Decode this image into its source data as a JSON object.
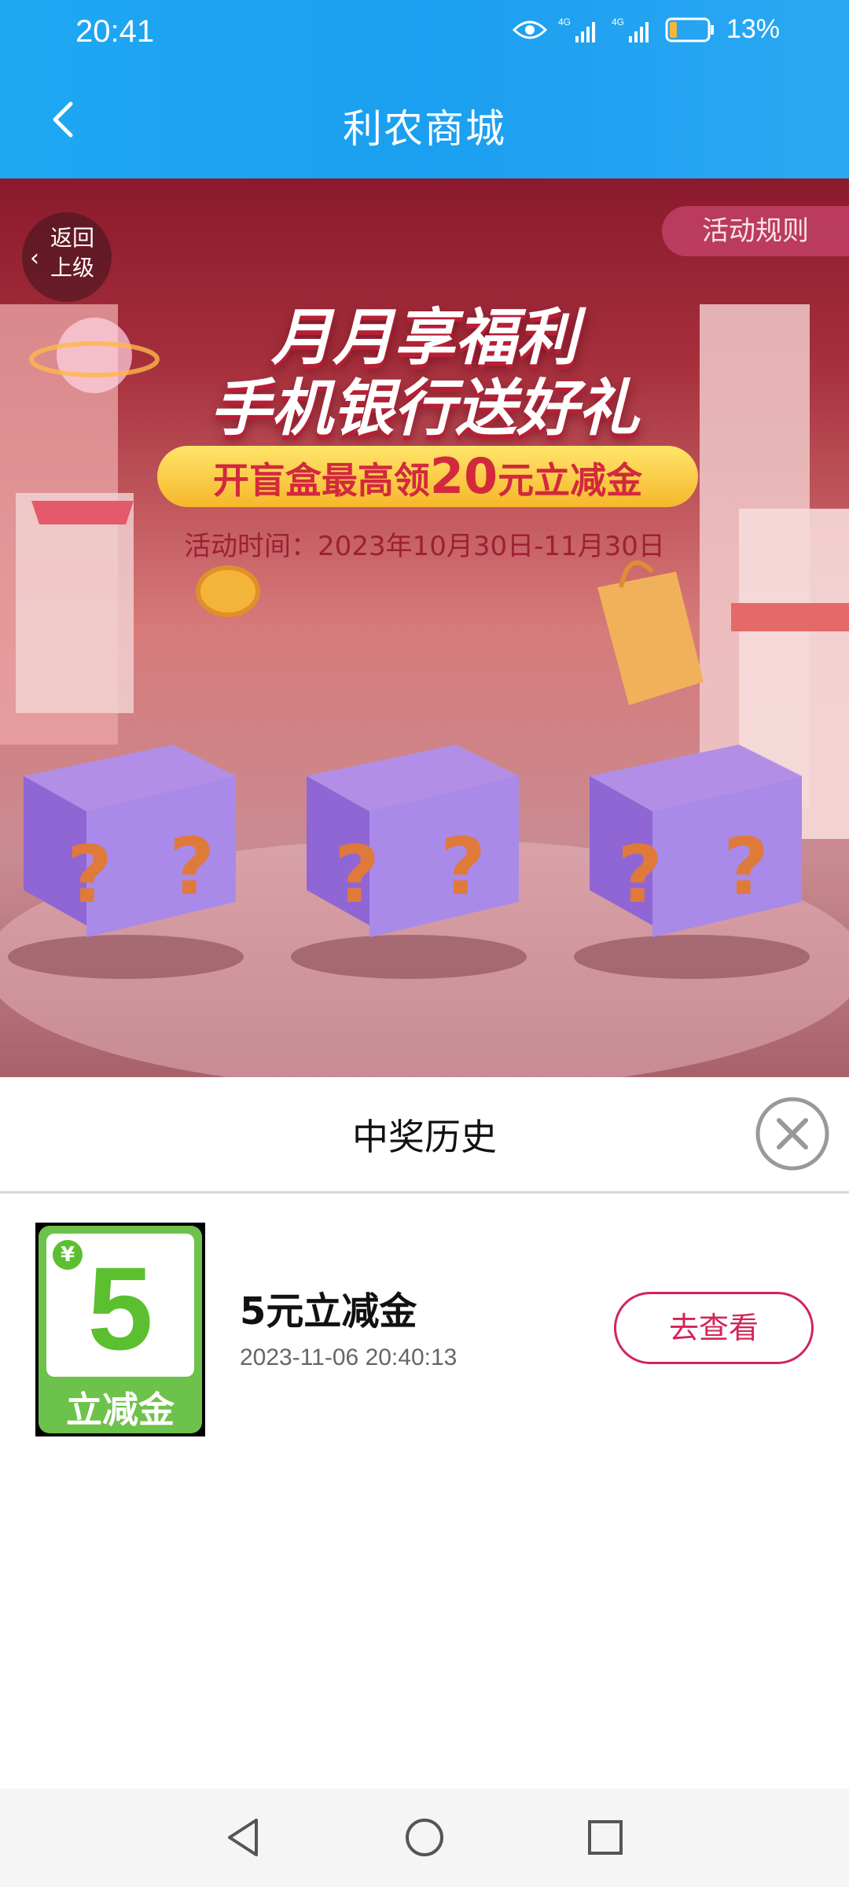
{
  "status_bar": {
    "time": "20:41",
    "network_1": "4G",
    "network_2": "4G",
    "battery": "13%"
  },
  "header": {
    "title": "利农商城"
  },
  "banner": {
    "return_label_1": "返回",
    "return_label_2": "上级",
    "rules_label": "活动规则",
    "title_line_1": "月月享福利",
    "title_line_2": "手机银行送好礼",
    "promo_prefix": "开盲盒最高领",
    "promo_amount": "20",
    "promo_suffix": "元立减金",
    "activity_time": "活动时间：2023年10月30日-11月30日",
    "box_mark": "?"
  },
  "sheet": {
    "title": "中奖历史",
    "prizes": [
      {
        "badge_currency": "¥",
        "badge_amount": "5",
        "badge_label": "立减金",
        "name": "5元立减金",
        "time": "2023-11-06 20:40:13",
        "action": "去查看"
      }
    ]
  },
  "colors": {
    "header_blue": "#1ea8f2",
    "accent_pink": "#d32458",
    "prize_green": "#5bbf2f"
  }
}
